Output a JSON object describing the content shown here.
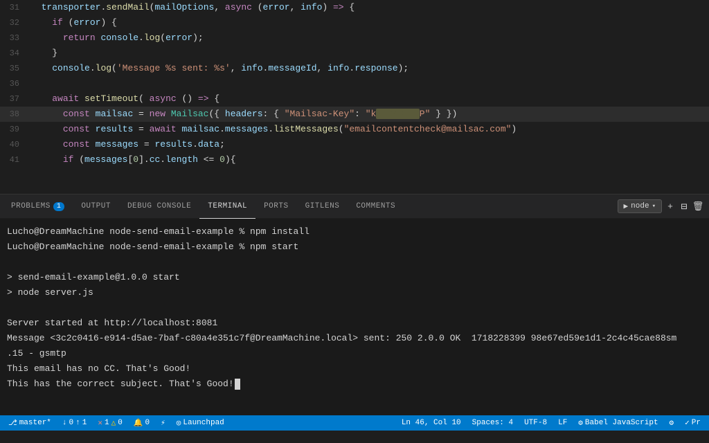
{
  "editor": {
    "lines": [
      {
        "num": 31,
        "tokens": [
          {
            "text": "  ",
            "cls": ""
          },
          {
            "text": "transporter",
            "cls": "var"
          },
          {
            "text": ".",
            "cls": "op"
          },
          {
            "text": "sendMail",
            "cls": "fn"
          },
          {
            "text": "(",
            "cls": "op"
          },
          {
            "text": "mailOptions",
            "cls": "var"
          },
          {
            "text": ", ",
            "cls": "op"
          },
          {
            "text": "async",
            "cls": "kw"
          },
          {
            "text": " (",
            "cls": "op"
          },
          {
            "text": "error",
            "cls": "param"
          },
          {
            "text": ", ",
            "cls": "op"
          },
          {
            "text": "info",
            "cls": "param"
          },
          {
            "text": ") ",
            "cls": "op"
          },
          {
            "text": "=>",
            "cls": "arrow"
          },
          {
            "text": " {",
            "cls": "op"
          }
        ],
        "highlight": false
      },
      {
        "num": 32,
        "tokens": [
          {
            "text": "    ",
            "cls": ""
          },
          {
            "text": "if",
            "cls": "kw"
          },
          {
            "text": " (",
            "cls": "op"
          },
          {
            "text": "error",
            "cls": "var"
          },
          {
            "text": ") {",
            "cls": "op"
          }
        ],
        "highlight": false
      },
      {
        "num": 33,
        "tokens": [
          {
            "text": "      ",
            "cls": ""
          },
          {
            "text": "return",
            "cls": "kw"
          },
          {
            "text": " ",
            "cls": ""
          },
          {
            "text": "console",
            "cls": "var"
          },
          {
            "text": ".",
            "cls": "op"
          },
          {
            "text": "log",
            "cls": "fn"
          },
          {
            "text": "(",
            "cls": "op"
          },
          {
            "text": "error",
            "cls": "var"
          },
          {
            "text": ");",
            "cls": "op"
          }
        ],
        "highlight": false
      },
      {
        "num": 34,
        "tokens": [
          {
            "text": "    }",
            "cls": "op"
          }
        ],
        "highlight": false
      },
      {
        "num": 35,
        "tokens": [
          {
            "text": "    ",
            "cls": ""
          },
          {
            "text": "console",
            "cls": "var"
          },
          {
            "text": ".",
            "cls": "op"
          },
          {
            "text": "log",
            "cls": "fn"
          },
          {
            "text": "(",
            "cls": "op"
          },
          {
            "text": "'Message %s sent: %s'",
            "cls": "str"
          },
          {
            "text": ", ",
            "cls": "op"
          },
          {
            "text": "info",
            "cls": "var"
          },
          {
            "text": ".",
            "cls": "op"
          },
          {
            "text": "messageId",
            "cls": "prop"
          },
          {
            "text": ", ",
            "cls": "op"
          },
          {
            "text": "info",
            "cls": "var"
          },
          {
            "text": ".",
            "cls": "op"
          },
          {
            "text": "response",
            "cls": "prop"
          },
          {
            "text": ");",
            "cls": "op"
          }
        ],
        "highlight": false
      },
      {
        "num": 36,
        "tokens": [
          {
            "text": "",
            "cls": ""
          }
        ],
        "highlight": false
      },
      {
        "num": 37,
        "tokens": [
          {
            "text": "    ",
            "cls": ""
          },
          {
            "text": "await",
            "cls": "kw"
          },
          {
            "text": " ",
            "cls": ""
          },
          {
            "text": "setTimeout",
            "cls": "fn"
          },
          {
            "text": "( ",
            "cls": "op"
          },
          {
            "text": "async",
            "cls": "kw"
          },
          {
            "text": " () ",
            "cls": "op"
          },
          {
            "text": "=>",
            "cls": "arrow"
          },
          {
            "text": " {",
            "cls": "op"
          }
        ],
        "highlight": false
      },
      {
        "num": 38,
        "tokens": [
          {
            "text": "      ",
            "cls": ""
          },
          {
            "text": "const",
            "cls": "kw"
          },
          {
            "text": " ",
            "cls": ""
          },
          {
            "text": "mailsac",
            "cls": "var"
          },
          {
            "text": " = ",
            "cls": "op"
          },
          {
            "text": "new",
            "cls": "kw"
          },
          {
            "text": " ",
            "cls": ""
          },
          {
            "text": "Mailsac",
            "cls": "type"
          },
          {
            "text": "({ ",
            "cls": "op"
          },
          {
            "text": "headers",
            "cls": "prop"
          },
          {
            "text": ": { ",
            "cls": "op"
          },
          {
            "text": "\"Mailsac-Key\"",
            "cls": "str"
          },
          {
            "text": ": ",
            "cls": "op"
          },
          {
            "text": "\"k",
            "cls": "str"
          },
          {
            "text": "REDACTED",
            "cls": "redacted"
          },
          {
            "text": "P\"",
            "cls": "str"
          },
          {
            "text": " } })  ",
            "cls": "op"
          }
        ],
        "highlight": true
      },
      {
        "num": 39,
        "tokens": [
          {
            "text": "      ",
            "cls": ""
          },
          {
            "text": "const",
            "cls": "kw"
          },
          {
            "text": " ",
            "cls": ""
          },
          {
            "text": "results",
            "cls": "var"
          },
          {
            "text": " = ",
            "cls": "op"
          },
          {
            "text": "await",
            "cls": "kw"
          },
          {
            "text": " ",
            "cls": ""
          },
          {
            "text": "mailsac",
            "cls": "var"
          },
          {
            "text": ".",
            "cls": "op"
          },
          {
            "text": "messages",
            "cls": "prop"
          },
          {
            "text": ".",
            "cls": "op"
          },
          {
            "text": "listMessages",
            "cls": "fn"
          },
          {
            "text": "(",
            "cls": "op"
          },
          {
            "text": "\"emailcontentcheck@mailsac.com\"",
            "cls": "str"
          },
          {
            "text": ")",
            "cls": "op"
          }
        ],
        "highlight": false
      },
      {
        "num": 40,
        "tokens": [
          {
            "text": "      ",
            "cls": ""
          },
          {
            "text": "const",
            "cls": "kw"
          },
          {
            "text": " ",
            "cls": ""
          },
          {
            "text": "messages",
            "cls": "var"
          },
          {
            "text": " = ",
            "cls": "op"
          },
          {
            "text": "results",
            "cls": "var"
          },
          {
            "text": ".",
            "cls": "op"
          },
          {
            "text": "data",
            "cls": "prop"
          },
          {
            "text": ";",
            "cls": "op"
          }
        ],
        "highlight": false
      },
      {
        "num": 41,
        "tokens": [
          {
            "text": "      ",
            "cls": ""
          },
          {
            "text": "if",
            "cls": "kw"
          },
          {
            "text": " (",
            "cls": "op"
          },
          {
            "text": "messages",
            "cls": "var"
          },
          {
            "text": "[",
            "cls": "op"
          },
          {
            "text": "0",
            "cls": "num"
          },
          {
            "text": "].",
            "cls": "op"
          },
          {
            "text": "cc",
            "cls": "prop"
          },
          {
            "text": ".",
            "cls": "op"
          },
          {
            "text": "length",
            "cls": "prop"
          },
          {
            "text": " <= ",
            "cls": "op"
          },
          {
            "text": "0",
            "cls": "num"
          },
          {
            "text": "){",
            "cls": "op"
          }
        ],
        "highlight": false
      }
    ]
  },
  "panel": {
    "tabs": [
      {
        "id": "problems",
        "label": "PROBLEMS",
        "badge": "1",
        "active": false
      },
      {
        "id": "output",
        "label": "OUTPUT",
        "badge": null,
        "active": false
      },
      {
        "id": "debug-console",
        "label": "DEBUG CONSOLE",
        "badge": null,
        "active": false
      },
      {
        "id": "terminal",
        "label": "TERMINAL",
        "badge": null,
        "active": true
      },
      {
        "id": "ports",
        "label": "PORTS",
        "badge": null,
        "active": false
      },
      {
        "id": "gitlens",
        "label": "GITLENS",
        "badge": null,
        "active": false
      },
      {
        "id": "comments",
        "label": "COMMENTS",
        "badge": null,
        "active": false
      }
    ],
    "actions": {
      "node_label": "node",
      "add_label": "+",
      "split_icon": "⊟",
      "trash_icon": "🗑"
    }
  },
  "terminal": {
    "lines": [
      {
        "type": "prompt",
        "text": "Lucho@DreamMachine node-send-email-example % npm install"
      },
      {
        "type": "prompt",
        "text": "Lucho@DreamMachine node-send-email-example % npm start"
      },
      {
        "type": "blank",
        "text": ""
      },
      {
        "type": "info",
        "text": "> send-email-example@1.0.0 start"
      },
      {
        "type": "info",
        "text": "> node server.js"
      },
      {
        "type": "blank",
        "text": ""
      },
      {
        "type": "output",
        "text": "Server started at http://localhost:8081"
      },
      {
        "type": "output",
        "text": "Message <3c2c0416-e914-d5ae-7baf-c80a4e351c7f@DreamMachine.local> sent: 250 2.0.0 OK  1718228399 98e67ed59e1d1-2c4c45cae88sm"
      },
      {
        "type": "output",
        "text": ".15 - gsmtp"
      },
      {
        "type": "output",
        "text": "This email has no CC. That's Good!"
      },
      {
        "type": "cursor",
        "text": "This has the correct subject. That's Good!"
      }
    ]
  },
  "statusbar": {
    "branch": "master*",
    "sync_down": "↓0",
    "sync_up": "↑1",
    "errors": "1",
    "warnings": "0",
    "notifications": "0",
    "remote": "",
    "position": "Ln 46, Col 10",
    "spaces": "Spaces: 4",
    "encoding": "UTF-8",
    "line_ending": "LF",
    "language": "Babel JavaScript",
    "launchpad": "Launchpad"
  }
}
